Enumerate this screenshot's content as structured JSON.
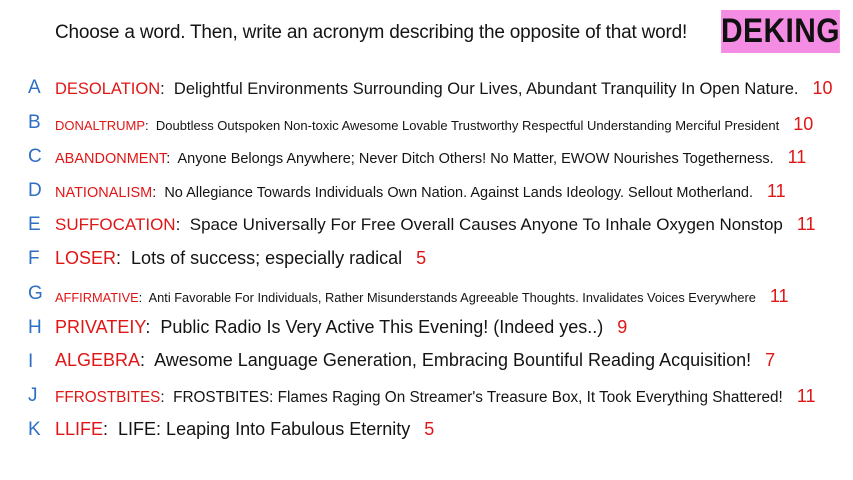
{
  "header": {
    "prompt": "Choose a word. Then, write an acronym describing the opposite of that word!",
    "badge": "DEKING"
  },
  "colors": {
    "letter": "#2d6fc4",
    "word": "#e01616",
    "score": "#e01616",
    "badge_bg": "#f48ce4"
  },
  "entries": [
    {
      "letter": "A",
      "word": "DESOLATION",
      "definition": "Delightful Environments Surrounding Our Lives, Abundant Tranquility In Open Nature.",
      "score": "10"
    },
    {
      "letter": "B",
      "word": "DONALTRUMP",
      "definition": "Doubtless Outspoken Non-toxic Awesome Lovable Trustworthy Respectful Understanding Merciful President",
      "score": "10"
    },
    {
      "letter": "C",
      "word": "ABANDONMENT",
      "definition": "Anyone Belongs Anywhere; Never Ditch Others! No Matter, EWOW Nourishes Togetherness.",
      "score": "11"
    },
    {
      "letter": "D",
      "word": "NATIONALISM",
      "definition": "No Allegiance Towards Individuals Own Nation. Against Lands Ideology. Sellout Motherland.",
      "score": "11"
    },
    {
      "letter": "E",
      "word": "SUFFOCATION",
      "definition": "Space Universally For Free Overall Causes Anyone To Inhale Oxygen Nonstop",
      "score": "11"
    },
    {
      "letter": "F",
      "word": "LOSER",
      "definition": "Lots of success; especially radical",
      "score": "5"
    },
    {
      "letter": "G",
      "word": "AFFIRMATIVE",
      "definition": "Anti Favorable For Individuals, Rather Misunderstands Agreeable Thoughts. Invalidates Voices Everywhere",
      "score": "11"
    },
    {
      "letter": "H",
      "word": "PRIVATEIY",
      "definition": "Public Radio Is Very Active This Evening! (Indeed yes..)",
      "score": "9"
    },
    {
      "letter": "I",
      "word": "ALGEBRA",
      "definition": "Awesome Language Generation, Embracing Bountiful Reading Acquisition!",
      "score": "7"
    },
    {
      "letter": "J",
      "word": "FFROSTBITES",
      "definition": "FROSTBITES: Flames Raging On Streamer's Treasure Box, It Took Everything Shattered!",
      "score": "11"
    },
    {
      "letter": "K",
      "word": "LLIFE",
      "definition": "LIFE: Leaping Into Fabulous Eternity",
      "score": "5"
    }
  ]
}
